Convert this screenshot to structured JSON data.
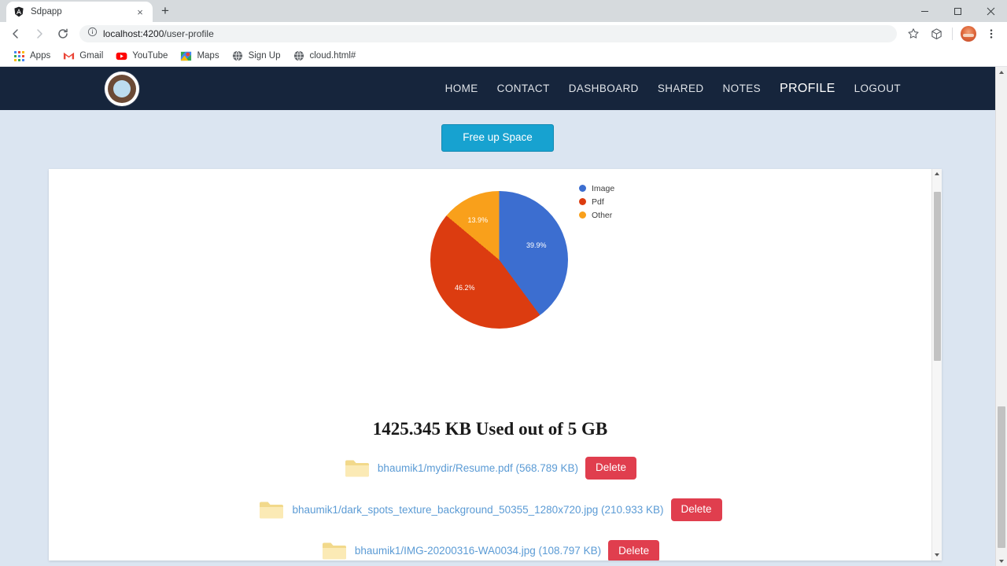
{
  "browser": {
    "tab": {
      "title": "Sdpapp",
      "favicon": "angular-shield-icon",
      "close": "×"
    },
    "newtab_label": "+",
    "window_controls": {
      "minimize": "–",
      "maximize": "❐",
      "close": "×"
    },
    "toolbar": {
      "back": "←",
      "forward": "→",
      "reload": "⟳",
      "site_info": "ⓘ",
      "url_host": "localhost:4200",
      "url_path": "/user-profile",
      "bookmark_star": "☆",
      "extensions": "cube-icon",
      "profile_avatar": "avatar-icon",
      "menu": "⋮"
    },
    "bookmarks": [
      {
        "label": "Apps",
        "icon": "apps-grid-icon"
      },
      {
        "label": "Gmail",
        "icon": "gmail-icon"
      },
      {
        "label": "YouTube",
        "icon": "youtube-icon"
      },
      {
        "label": "Maps",
        "icon": "maps-icon"
      },
      {
        "label": "Sign Up",
        "icon": "globe-icon"
      },
      {
        "label": "cloud.html#",
        "icon": "globe-icon"
      }
    ]
  },
  "app": {
    "navbar": {
      "brand": "logo-icon",
      "links": [
        {
          "label": "HOME",
          "active": false
        },
        {
          "label": "CONTACT",
          "active": false
        },
        {
          "label": "DASHBOARD",
          "active": false
        },
        {
          "label": "SHARED",
          "active": false
        },
        {
          "label": "NOTES",
          "active": false
        },
        {
          "label": "PROFILE",
          "active": true
        },
        {
          "label": "LOGOUT",
          "active": false
        }
      ],
      "bg_color": "#16253c"
    },
    "free_up_space_label": "Free up Space",
    "usage_heading": "1425.345 KB Used out of 5 GB",
    "files": [
      {
        "name": "bhaumik1/mydir/Resume.pdf (568.789 KB)",
        "delete_label": "Delete"
      },
      {
        "name": "bhaumik1/dark_spots_texture_background_50355_1280x720.jpg (210.933 KB)",
        "delete_label": "Delete"
      },
      {
        "name": "bhaumik1/IMG-20200316-WA0034.jpg (108.797 KB)",
        "delete_label": "Delete"
      }
    ],
    "colors": {
      "accent_button": "#17a2d0",
      "delete_button": "#e03e4e",
      "link": "#5b9bd5",
      "page_bg": "#dbe5f1"
    }
  },
  "chart_data": {
    "type": "pie",
    "title": "",
    "categories": [
      "Image",
      "Pdf",
      "Other"
    ],
    "values": [
      39.9,
      46.2,
      13.9
    ],
    "labels": [
      "39.9%",
      "46.2%",
      "13.9%"
    ],
    "colors": [
      "#3c6ed0",
      "#dc3c10",
      "#f9a01b"
    ],
    "legend_position": "right",
    "units": "percent"
  }
}
